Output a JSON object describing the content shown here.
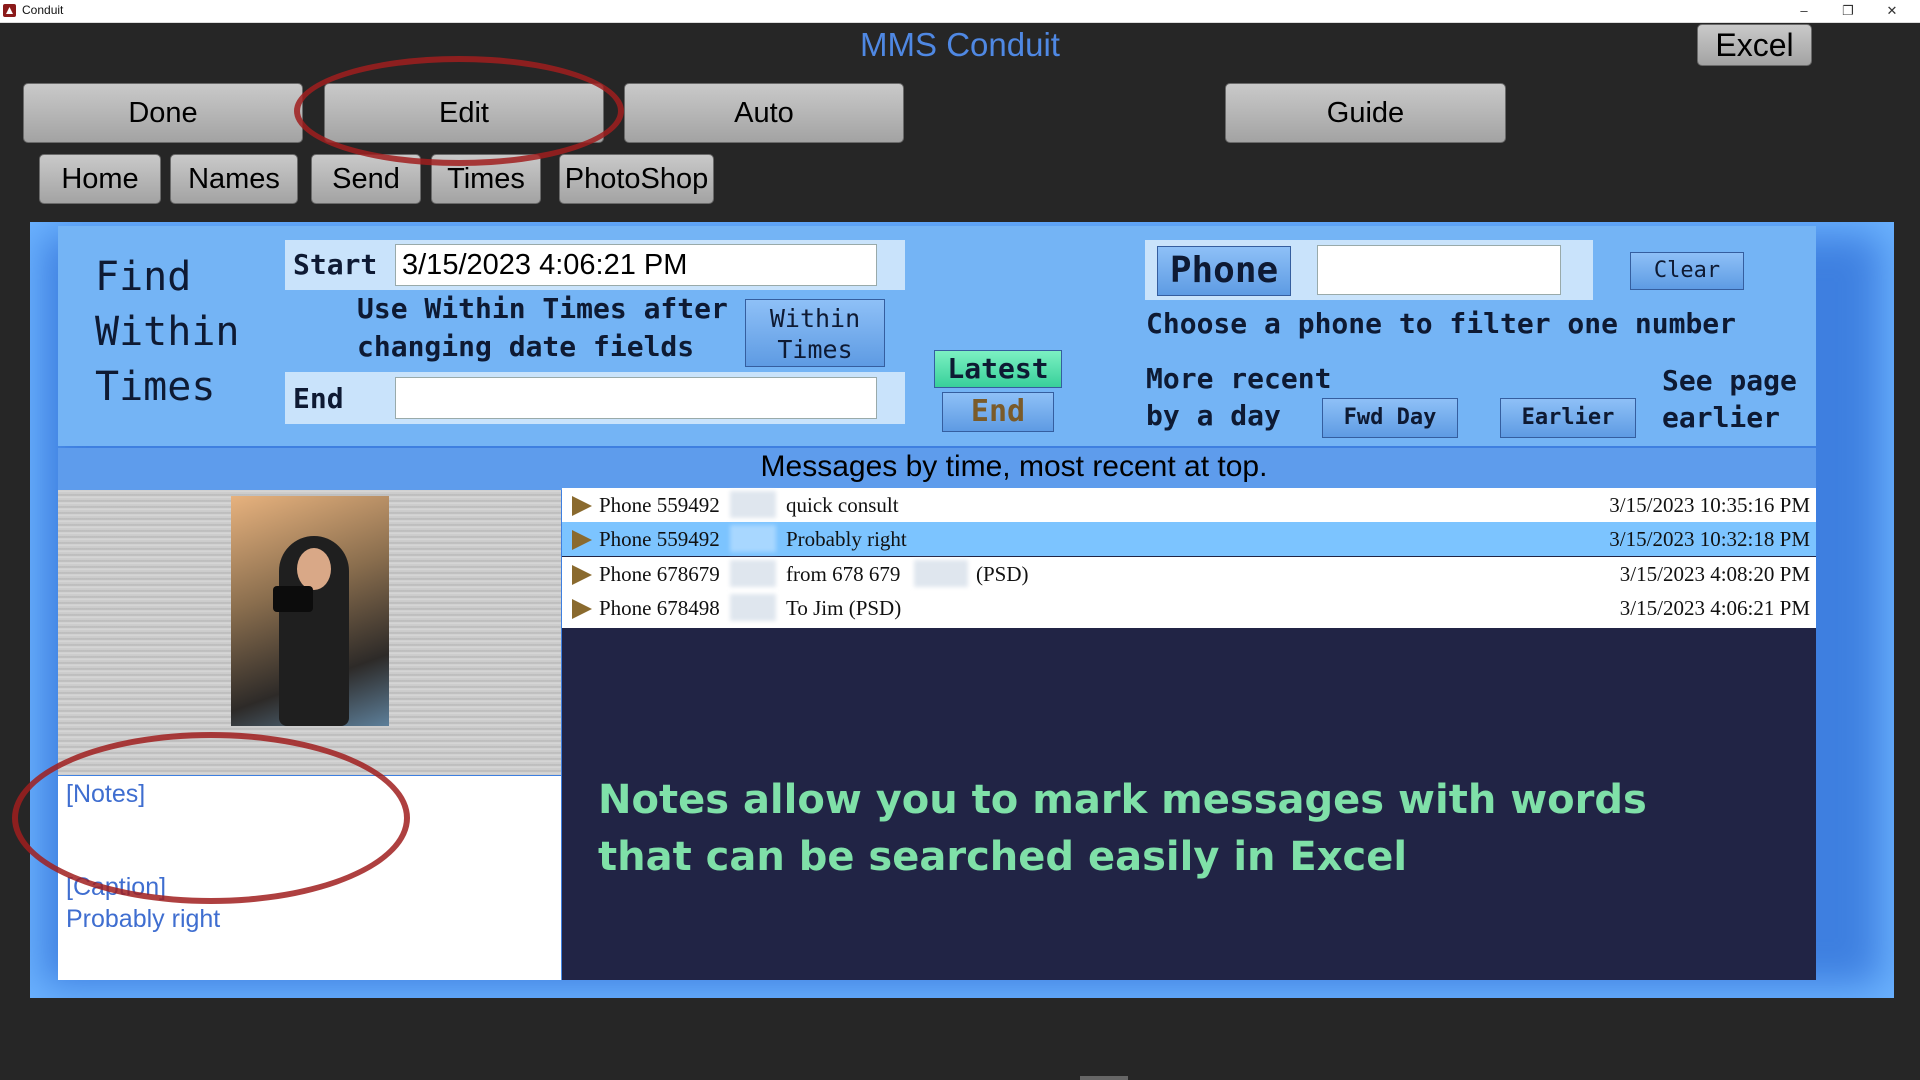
{
  "window": {
    "title": "Conduit",
    "minimize": "–",
    "restore": "❐",
    "close": "✕"
  },
  "app": {
    "title": "MMS Conduit",
    "excel_button": "Excel"
  },
  "toolbar": {
    "primary": [
      {
        "label": "Done"
      },
      {
        "label": "Edit"
      },
      {
        "label": "Auto"
      },
      {
        "label": "Guide"
      }
    ],
    "secondary": [
      {
        "label": "Home"
      },
      {
        "label": "Names"
      },
      {
        "label": "Send"
      },
      {
        "label": "Times"
      },
      {
        "label": "PhotoShop"
      }
    ]
  },
  "filter": {
    "heading_line1": "Find",
    "heading_line2": "Within",
    "heading_line3": "Times",
    "start_label": "Start",
    "start_value": "3/15/2023 4:06:21 PM",
    "end_label": "End",
    "end_value": "",
    "hint_line1": "Use Within Times after",
    "hint_line2": "changing date fields",
    "within_line1": "Within",
    "within_line2": "Times",
    "latest_button": "Latest",
    "end_button": "End",
    "phone_label": "Phone",
    "phone_value": "",
    "clear_button": "Clear",
    "phone_hint": "Choose a phone to filter one number",
    "more_recent_line1": "More recent",
    "more_recent_line2": "by a day",
    "fwd_day_button": "Fwd Day",
    "earlier_button": "Earlier",
    "see_page_line1": "See page",
    "see_page_line2": "earlier"
  },
  "messages": {
    "heading": "Messages by time, most recent at top.",
    "rows": [
      {
        "phone": "Phone 559492",
        "text": "quick consult",
        "time": "3/15/2023 10:35:16 PM",
        "selected": false
      },
      {
        "phone": "Phone 559492",
        "text": "Probably right",
        "time": "3/15/2023 10:32:18 PM",
        "selected": true
      },
      {
        "phone": "Phone 678679",
        "text": "from 678 679",
        "text_suffix": "(PSD)",
        "time": "3/15/2023 4:08:20 PM",
        "selected": false
      },
      {
        "phone": "Phone 678498",
        "text": "To Jim (PSD)",
        "time": "3/15/2023 4:06:21 PM",
        "selected": false
      }
    ]
  },
  "preview": {
    "notes_link": "[Notes]",
    "caption_link": "[Caption]",
    "caption_text": "Probably right"
  },
  "annotation": {
    "text": "Notes allow you to mark messages with words that can be searched easily in Excel",
    "ellipse_color": "#a01e1e"
  }
}
